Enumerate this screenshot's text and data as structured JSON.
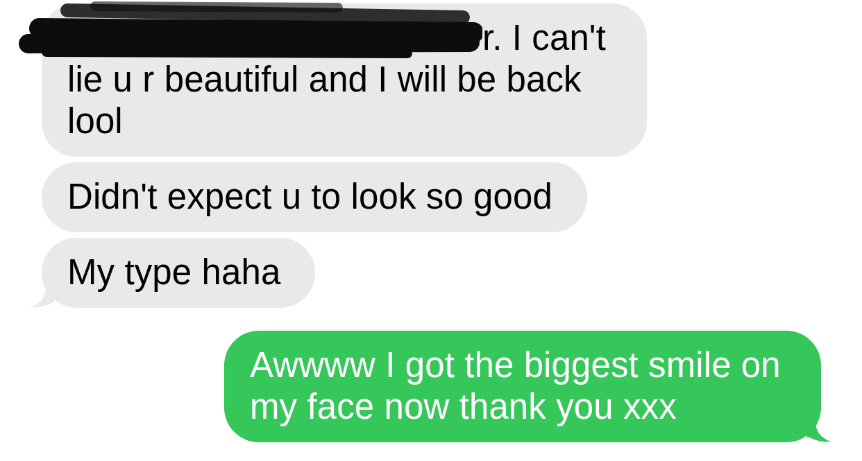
{
  "messages": [
    {
      "kind": "received",
      "redacted": true,
      "first_line": "r. I can't",
      "text": "lie u r beautiful and I will be back lool",
      "tail": false
    },
    {
      "kind": "received",
      "redacted": false,
      "text": "Didn't expect u to look so good",
      "tail": false
    },
    {
      "kind": "received",
      "redacted": false,
      "text": "My type haha",
      "tail": true
    },
    {
      "kind": "sent",
      "redacted": false,
      "text": "Awwww I got the biggest smile on my face now thank you xxx",
      "tail": true
    }
  ]
}
